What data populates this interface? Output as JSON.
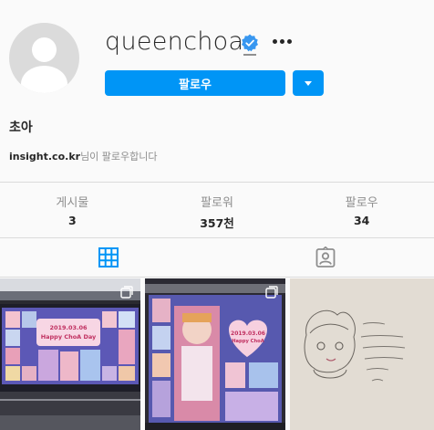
{
  "profile": {
    "username": "queenchoa_",
    "full_name": "초아",
    "followed_by_account": "insight.co.kr",
    "followed_by_suffix": "님이 팔로우합니다",
    "verified": true
  },
  "actions": {
    "follow_label": "팔로우"
  },
  "stats": [
    {
      "label": "게시물",
      "value": "3"
    },
    {
      "label": "팔로워",
      "value": "357천"
    },
    {
      "label": "팔로우",
      "value": "34"
    }
  ],
  "tabs": [
    {
      "icon": "grid-icon",
      "active": true
    },
    {
      "icon": "tagged-icon",
      "active": false
    }
  ],
  "posts": [
    {
      "type": "photo",
      "caption_text": "2019.03.06 Happy ChoA Day",
      "multi": true
    },
    {
      "type": "photo",
      "caption_text": "2019.03.06 Happy ChoA Day",
      "multi": true
    },
    {
      "type": "drawing",
      "multi": false
    }
  ],
  "colors": {
    "accent": "#0095f6",
    "verified": "#3897f0",
    "background": "#fafafa",
    "border": "#dbdbdb",
    "muted": "#8e8e8e",
    "text": "#262626"
  }
}
